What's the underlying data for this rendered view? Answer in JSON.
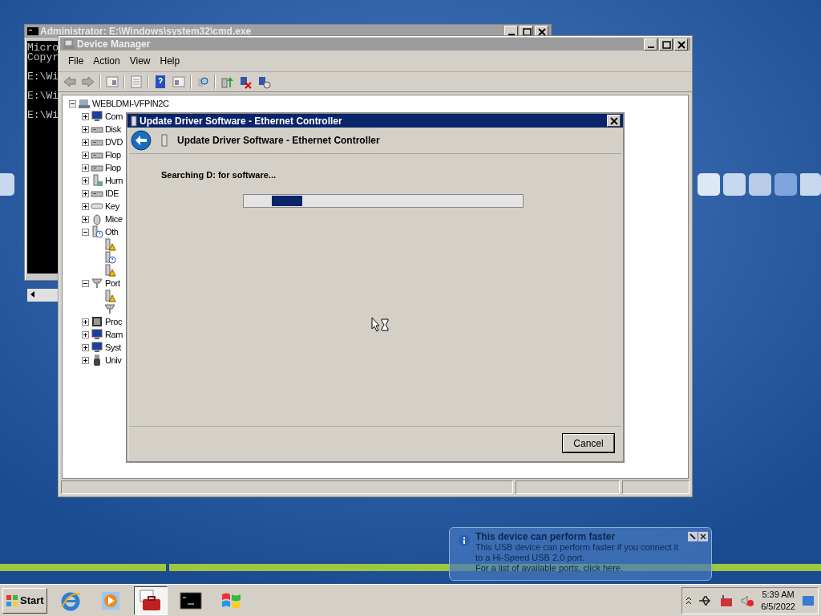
{
  "cmd_window": {
    "title": "Administrator: E:\\Windows\\system32\\cmd.exe",
    "lines": [
      "Micro",
      "Copyr",
      "E:\\Wi",
      "E:\\Wi",
      "E:\\Wi"
    ]
  },
  "device_manager": {
    "title": "Device Manager",
    "menu": [
      "File",
      "Action",
      "View",
      "Help"
    ],
    "tree": {
      "label": "WEBLDMI-VFPIN2C",
      "kind": "computer",
      "expanded": true,
      "children": [
        {
          "label": "Com",
          "kind": "monitor",
          "expanded": false
        },
        {
          "label": "Disk",
          "kind": "drive",
          "expanded": false
        },
        {
          "label": "DVD",
          "kind": "drive",
          "expanded": false
        },
        {
          "label": "Flop",
          "kind": "drive",
          "expanded": false
        },
        {
          "label": "Flop",
          "kind": "drive",
          "expanded": false
        },
        {
          "label": "Hum",
          "kind": "device",
          "expanded": false
        },
        {
          "label": "IDE",
          "kind": "drive",
          "expanded": false
        },
        {
          "label": "Key",
          "kind": "keyboard",
          "expanded": false
        },
        {
          "label": "Mice",
          "kind": "mouse",
          "expanded": false
        },
        {
          "label": "Oth",
          "kind": "unknown",
          "expanded": true,
          "children": [
            {
              "kind": "warning"
            },
            {
              "kind": "unknown"
            },
            {
              "kind": "warning"
            }
          ]
        },
        {
          "label": "Port",
          "kind": "port",
          "expanded": true,
          "children": [
            {
              "kind": "warning"
            },
            {
              "kind": "port"
            }
          ]
        },
        {
          "label": "Proc",
          "kind": "chip",
          "expanded": false
        },
        {
          "label": "Ram",
          "kind": "monitor",
          "expanded": false
        },
        {
          "label": "Syst",
          "kind": "monitor",
          "expanded": false
        },
        {
          "label": "Univ",
          "kind": "usb",
          "expanded": false
        }
      ]
    }
  },
  "dialog": {
    "title": "Update Driver Software - Ethernet Controller",
    "heading": "Update Driver Software - Ethernet Controller",
    "status": "Searching D: for software...",
    "cancel": "Cancel"
  },
  "notification": {
    "title": "This device can perform faster",
    "body": "This USB device can perform faster if you connect it to a Hi-Speed USB 2.0 port.",
    "link": "For a list of available ports, click here."
  },
  "taskbar": {
    "start": "Start",
    "buttons": [
      {
        "kind": "browser",
        "selected": false
      },
      {
        "kind": "media",
        "selected": false
      },
      {
        "kind": "toolbox",
        "selected": true
      },
      {
        "kind": "console",
        "selected": false
      },
      {
        "kind": "flag",
        "selected": false
      }
    ],
    "time": "5:39 AM",
    "date": "6/5/2022"
  }
}
